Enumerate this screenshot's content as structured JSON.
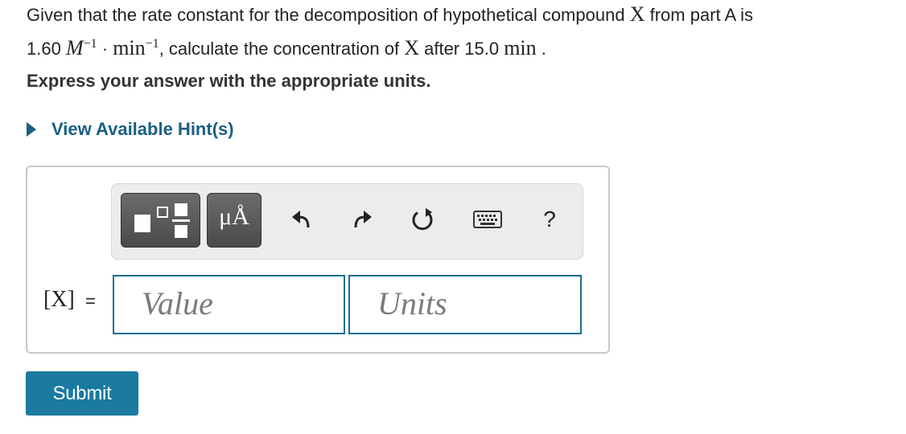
{
  "question": {
    "part1": "Given that the rate constant for the decomposition of hypothetical compound ",
    "compound": "X",
    "part2": " from part A is",
    "rate_value": "1.60 ",
    "unit_M": "M",
    "exp1": "−1",
    "dot": " · ",
    "unit_min": "min",
    "exp2": "−1",
    "part3": ", calculate the concentration of ",
    "compound2": "X",
    "part4": " after 15.0 ",
    "time_unit": "min",
    "part5": " ."
  },
  "instruction": "Express your answer with the appropriate units.",
  "hint": {
    "label": "View Available Hint(s)"
  },
  "toolbar": {
    "units_button_label": "μÅ",
    "tools": [
      "templates-icon",
      "units-icon",
      "undo-icon",
      "redo-icon",
      "reset-icon",
      "keyboard-icon",
      "help-icon"
    ],
    "help_label": "?"
  },
  "answer": {
    "variable_label": "[X]",
    "equals": "=",
    "value_placeholder": "Value",
    "units_placeholder": "Units"
  },
  "submit_label": "Submit",
  "colors": {
    "link": "#1a5f84",
    "submit": "#1a7aa0",
    "field_border": "#1a6f8f"
  }
}
